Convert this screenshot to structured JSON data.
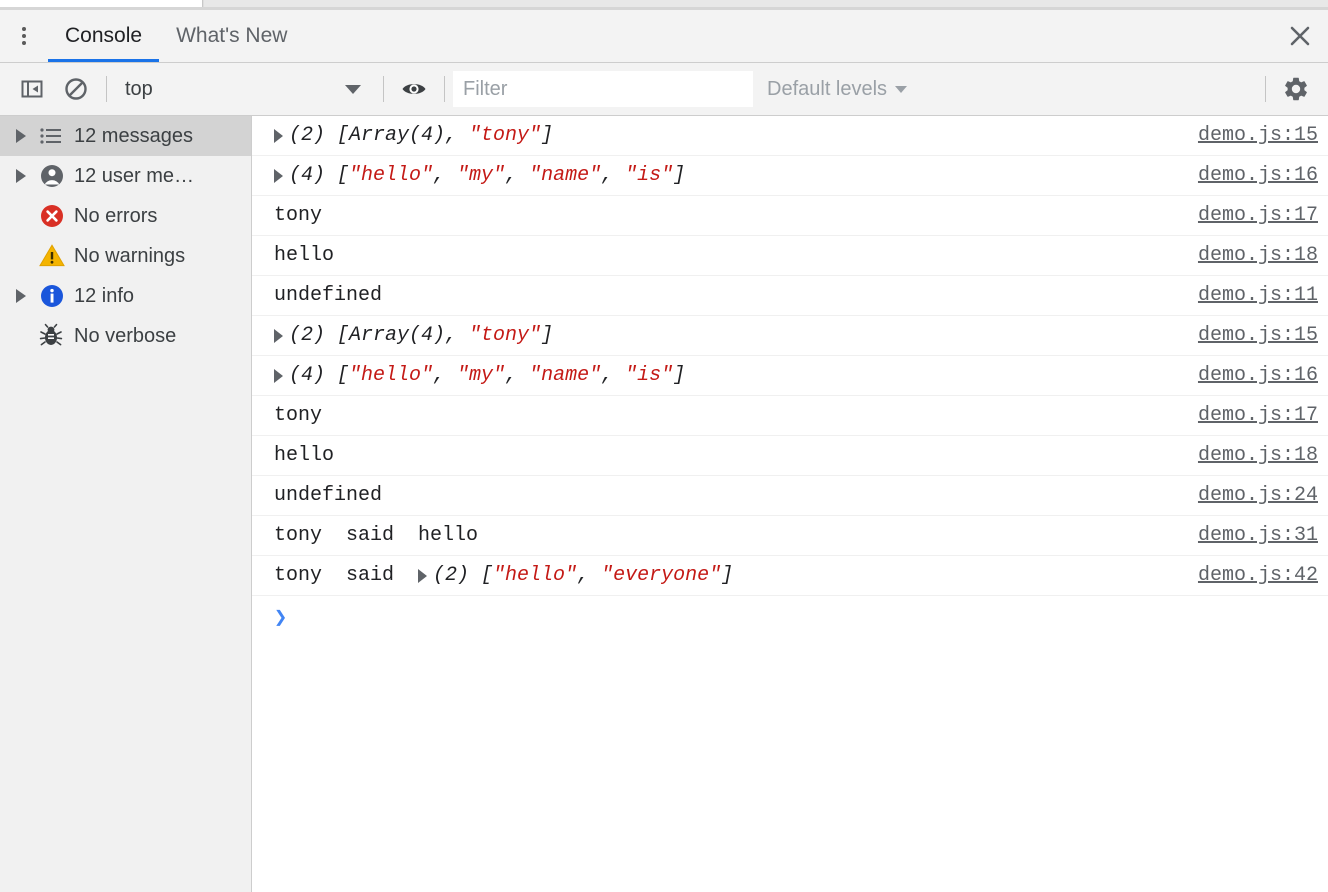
{
  "window": {
    "close_label": "✕",
    "kebab_name": "more-options"
  },
  "tabs": [
    {
      "label": "Console",
      "active": true
    },
    {
      "label": "What's New",
      "active": false
    }
  ],
  "toolbar": {
    "sidebar_toggle_icon": "show-console-sidebar-icon",
    "clear_icon": "clear-console-icon",
    "context": "top",
    "eye_icon": "live-expression-icon",
    "filter_value": "",
    "filter_placeholder": "Filter",
    "levels_label": "Default levels",
    "settings_icon": "gear-icon"
  },
  "sidebar": {
    "items": [
      {
        "label": "12 messages",
        "icon": "list-icon",
        "expandable": true,
        "selected": true
      },
      {
        "label": "12 user me…",
        "icon": "user-icon",
        "expandable": true,
        "selected": false
      },
      {
        "label": "No errors",
        "icon": "error-icon",
        "expandable": false,
        "selected": false
      },
      {
        "label": "No warnings",
        "icon": "warning-icon",
        "expandable": false,
        "selected": false
      },
      {
        "label": "12 info",
        "icon": "info-icon",
        "expandable": true,
        "selected": false
      },
      {
        "label": "No verbose",
        "icon": "verbose-bug-icon",
        "expandable": false,
        "selected": false
      }
    ]
  },
  "console": {
    "messages": [
      {
        "expandable": true,
        "dim": false,
        "parts": [
          {
            "text": "(2) [Array(4), ",
            "style": "arr"
          },
          {
            "text": "\"tony\"",
            "style": "str"
          },
          {
            "text": "]",
            "style": "arr"
          }
        ],
        "source": "demo.js:15"
      },
      {
        "expandable": true,
        "dim": false,
        "parts": [
          {
            "text": "(4) [",
            "style": "arr"
          },
          {
            "text": "\"hello\"",
            "style": "str"
          },
          {
            "text": ", ",
            "style": "arr"
          },
          {
            "text": "\"my\"",
            "style": "str"
          },
          {
            "text": ", ",
            "style": "arr"
          },
          {
            "text": "\"name\"",
            "style": "str"
          },
          {
            "text": ", ",
            "style": "arr"
          },
          {
            "text": "\"is\"",
            "style": "str"
          },
          {
            "text": "]",
            "style": "arr"
          }
        ],
        "source": "demo.js:16"
      },
      {
        "expandable": false,
        "dim": false,
        "parts": [
          {
            "text": "tony",
            "style": "plain"
          }
        ],
        "source": "demo.js:17"
      },
      {
        "expandable": false,
        "dim": false,
        "parts": [
          {
            "text": "hello",
            "style": "plain"
          }
        ],
        "source": "demo.js:18"
      },
      {
        "expandable": false,
        "dim": true,
        "parts": [
          {
            "text": "undefined",
            "style": "plain"
          }
        ],
        "source": "demo.js:11"
      },
      {
        "expandable": true,
        "dim": false,
        "parts": [
          {
            "text": "(2) [Array(4), ",
            "style": "arr"
          },
          {
            "text": "\"tony\"",
            "style": "str"
          },
          {
            "text": "]",
            "style": "arr"
          }
        ],
        "source": "demo.js:15"
      },
      {
        "expandable": true,
        "dim": false,
        "parts": [
          {
            "text": "(4) [",
            "style": "arr"
          },
          {
            "text": "\"hello\"",
            "style": "str"
          },
          {
            "text": ", ",
            "style": "arr"
          },
          {
            "text": "\"my\"",
            "style": "str"
          },
          {
            "text": ", ",
            "style": "arr"
          },
          {
            "text": "\"name\"",
            "style": "str"
          },
          {
            "text": ", ",
            "style": "arr"
          },
          {
            "text": "\"is\"",
            "style": "str"
          },
          {
            "text": "]",
            "style": "arr"
          }
        ],
        "source": "demo.js:16"
      },
      {
        "expandable": false,
        "dim": false,
        "parts": [
          {
            "text": "tony",
            "style": "plain"
          }
        ],
        "source": "demo.js:17"
      },
      {
        "expandable": false,
        "dim": false,
        "parts": [
          {
            "text": "hello",
            "style": "plain"
          }
        ],
        "source": "demo.js:18"
      },
      {
        "expandable": false,
        "dim": true,
        "parts": [
          {
            "text": "undefined",
            "style": "plain"
          }
        ],
        "source": "demo.js:24"
      },
      {
        "expandable": false,
        "dim": false,
        "parts": [
          {
            "text": "tony  said  hello",
            "style": "plain"
          }
        ],
        "source": "demo.js:31"
      },
      {
        "expandable": false,
        "dim": false,
        "prefix": "tony  said  ",
        "inline_expandable": true,
        "parts": [
          {
            "text": "(2) [",
            "style": "arr"
          },
          {
            "text": "\"hello\"",
            "style": "str"
          },
          {
            "text": ", ",
            "style": "arr"
          },
          {
            "text": "\"everyone\"",
            "style": "str"
          },
          {
            "text": "]",
            "style": "arr"
          }
        ],
        "source": "demo.js:42"
      }
    ],
    "prompt": "❯"
  },
  "colors": {
    "accent": "#1a73e8",
    "string": "#c41a16",
    "error": "#d93025",
    "warning": "#f4b400",
    "info": "#1a73e8",
    "prompt": "#4285f4",
    "chrome_bg": "#f3f3f3",
    "sidebar_bg": "#f1f1f1"
  }
}
